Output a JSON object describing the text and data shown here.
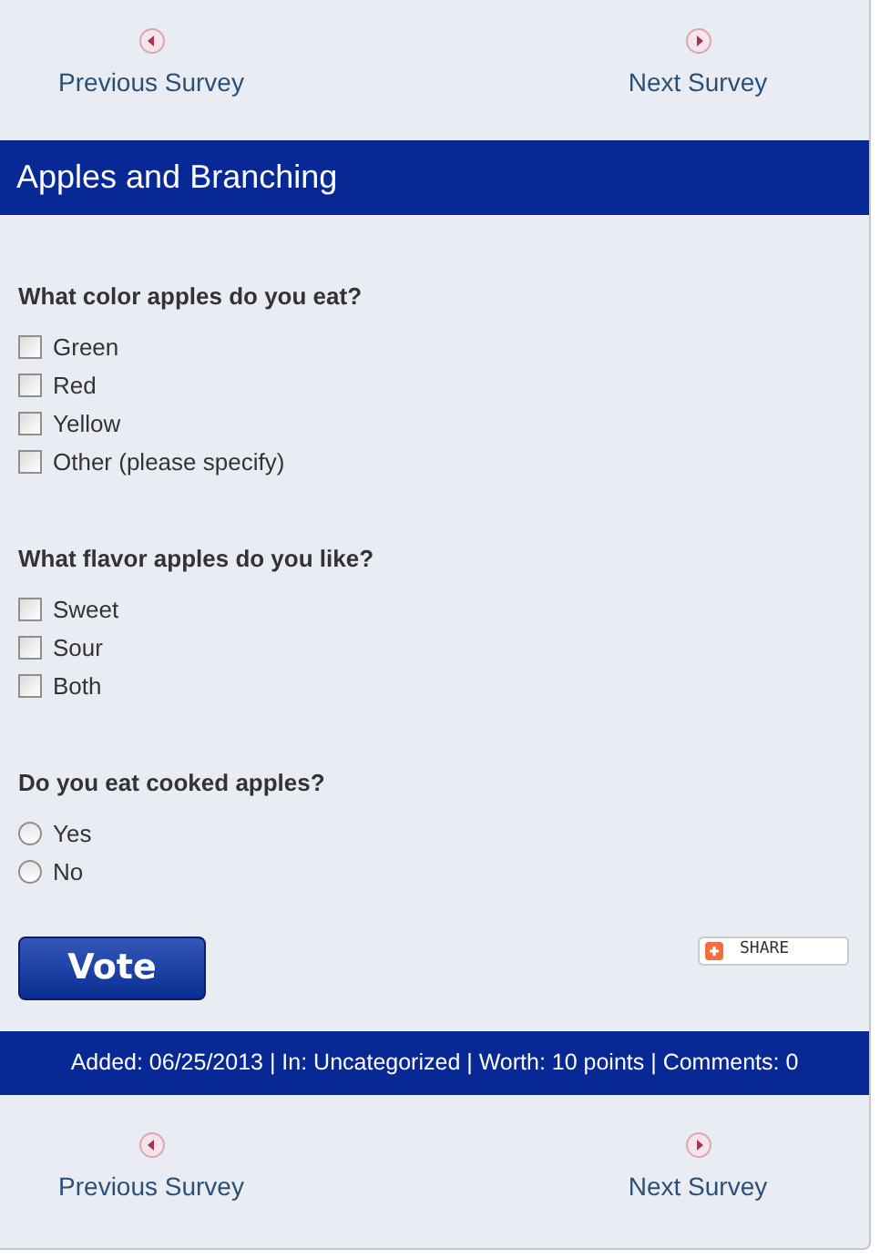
{
  "top_nav": {
    "previous": "Previous Survey",
    "next": "Next Survey"
  },
  "title": "Apples and Branching",
  "questions": [
    {
      "text": "What color apples do you eat?",
      "kind": "checkbox",
      "options": [
        {
          "label": "Green",
          "checked": false
        },
        {
          "label": "Red",
          "checked": false
        },
        {
          "label": "Yellow",
          "checked": false
        },
        {
          "label": "Other (please specify)",
          "checked": false
        }
      ]
    },
    {
      "text": "What flavor apples do you like?",
      "kind": "checkbox",
      "options": [
        {
          "label": "Sweet",
          "checked": false
        },
        {
          "label": "Sour",
          "checked": false
        },
        {
          "label": "Both",
          "checked": false
        }
      ]
    },
    {
      "text": "Do you eat cooked apples?",
      "kind": "radio",
      "options": [
        {
          "label": "Yes",
          "selected": false
        },
        {
          "label": "No",
          "selected": false
        }
      ]
    }
  ],
  "vote_button": "Vote",
  "share_button": "SHARE",
  "footer": "Added: 06/25/2013 | In: Uncategorized | Worth: 10 points | Comments: 0",
  "bottom_nav": {
    "previous": "Previous Survey",
    "next": "Next Survey"
  }
}
